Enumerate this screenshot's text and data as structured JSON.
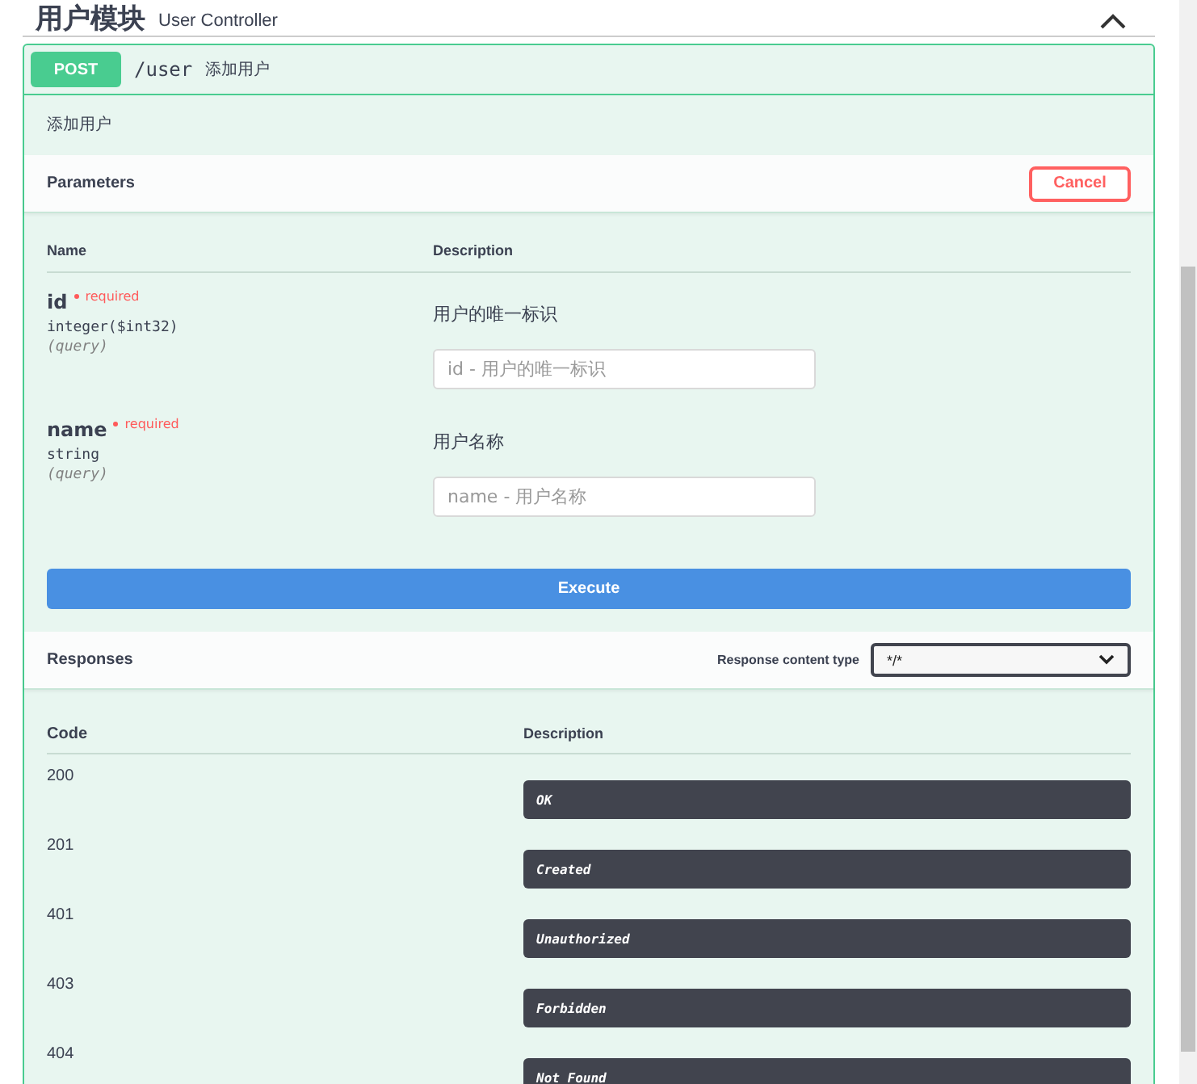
{
  "section": {
    "title": "用户模块",
    "subtitle": "User Controller",
    "expanded": true
  },
  "operation": {
    "method": "POST",
    "path": "/user",
    "summary": "添加用户",
    "description": "添加用户"
  },
  "parameters": {
    "title": "Parameters",
    "cancel_button": "Cancel",
    "columns": [
      "Name",
      "Description"
    ],
    "rows": [
      {
        "name": "id",
        "required": true,
        "required_label": "required",
        "type": "integer($int32)",
        "location": "(query)",
        "description": "用户的唯一标识",
        "placeholder": "id - 用户的唯一标识"
      },
      {
        "name": "name",
        "required": true,
        "required_label": "required",
        "type": "string",
        "location": "(query)",
        "description": "用户名称",
        "placeholder": "name - 用户名称"
      }
    ]
  },
  "execute_button": "Execute",
  "responses": {
    "title": "Responses",
    "content_type_label": "Response content type",
    "content_type": "*/*",
    "columns": [
      "Code",
      "Description"
    ],
    "rows": [
      {
        "code": "200",
        "description": "OK"
      },
      {
        "code": "201",
        "description": "Created"
      },
      {
        "code": "401",
        "description": "Unauthorized"
      },
      {
        "code": "403",
        "description": "Forbidden"
      },
      {
        "code": "404",
        "description": "Not Found"
      }
    ]
  }
}
